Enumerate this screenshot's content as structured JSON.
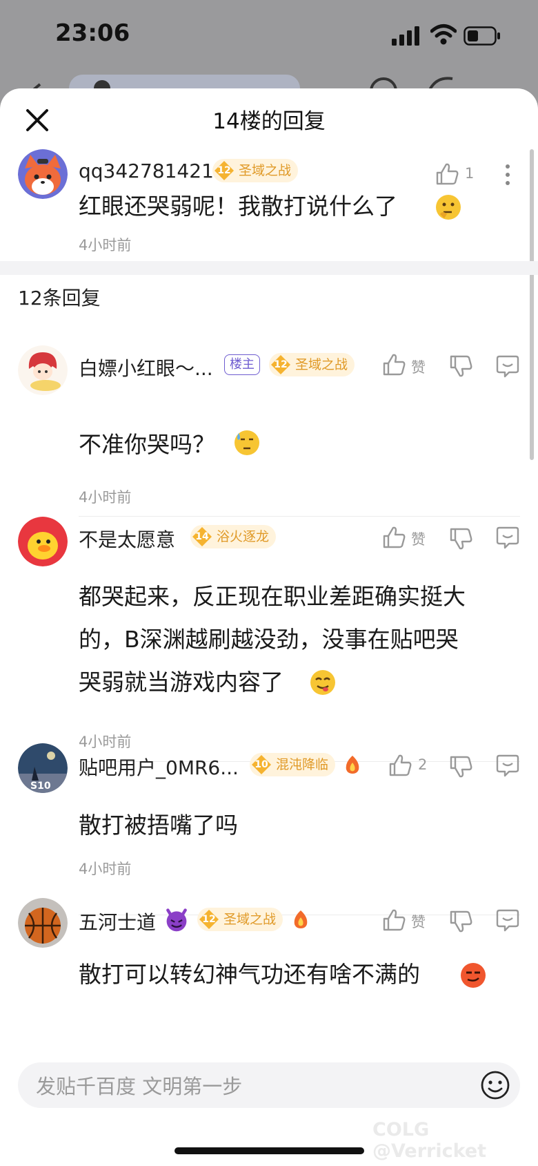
{
  "status": {
    "time": "23:06"
  },
  "header": {
    "title": "14楼的回复"
  },
  "main_post": {
    "username": "qq342781421",
    "badge_level": "12",
    "badge_name": "圣域之战",
    "likes": "1",
    "content": "红眼还哭弱呢！我散打说什么了",
    "time": "4小时前"
  },
  "section": {
    "title": "12条回复"
  },
  "replies": [
    {
      "username": "白嫖小红眼～...",
      "tag": "楼主",
      "badge_level": "12",
      "badge_name": "圣域之战",
      "likes": "赞",
      "content": "不准你哭吗？",
      "time": "4小时前"
    },
    {
      "username": "不是太愿意",
      "badge_level": "14",
      "badge_name": "浴火逐龙",
      "likes": "赞",
      "content": [
        "都哭起来，反正现在职业差距确实挺大",
        "的，B深渊越刷越没劲，没事在贴吧哭",
        "哭弱就当游戏内容了"
      ],
      "time": "4小时前"
    },
    {
      "username": "贴吧用户_0MR6...",
      "avatar_text": "S10",
      "badge_level": "10",
      "badge_name": "混沌降临",
      "likes": "2",
      "content": "散打被捂嘴了吗",
      "time": "4小时前"
    },
    {
      "username": "五河士道",
      "badge_level": "12",
      "badge_name": "圣域之战",
      "likes": "赞",
      "content": "散打可以转幻神气功还有啥不满的"
    }
  ],
  "footer": {
    "placeholder": "发贴千百度 文明第一步"
  },
  "watermark": "COLG @Verricket",
  "colors": {
    "accent_orange": "#f5b330",
    "badge_bg": "#fff3dc",
    "tag_purple": "#6d5bd0",
    "muted": "#9a9a9a"
  }
}
